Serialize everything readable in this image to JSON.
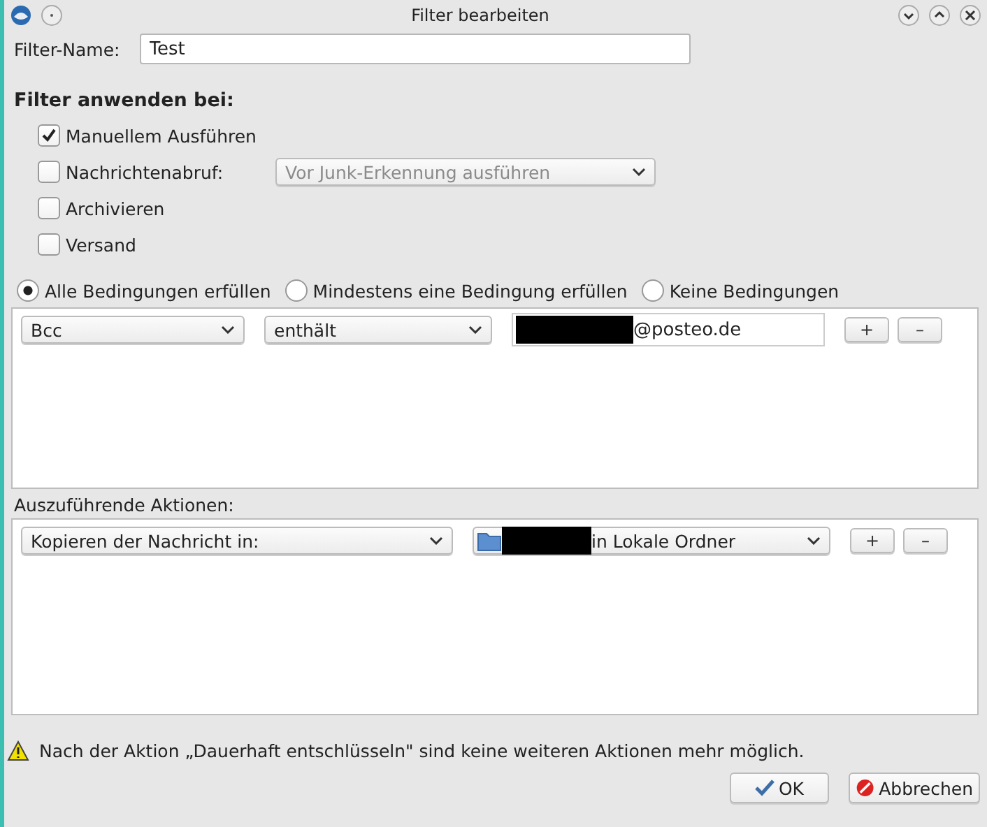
{
  "window": {
    "title": "Filter bearbeiten"
  },
  "filter_name": {
    "label": "Filter-Name:",
    "value": "Test"
  },
  "apply_section": {
    "heading": "Filter anwenden bei:",
    "options": [
      {
        "label": "Manuellem Ausführen",
        "checked": true
      },
      {
        "label": "Nachrichtenabruf:",
        "checked": false,
        "dropdown": {
          "value": "Vor Junk-Erkennung ausführen",
          "disabled": true
        }
      },
      {
        "label": "Archivieren",
        "checked": false
      },
      {
        "label": "Versand",
        "checked": false
      }
    ]
  },
  "match_modes": [
    {
      "label": "Alle Bedingungen erfüllen",
      "selected": true
    },
    {
      "label": "Mindestens eine Bedingung erfüllen",
      "selected": false
    },
    {
      "label": "Keine Bedingungen",
      "selected": false
    }
  ],
  "conditions": [
    {
      "field": "Bcc",
      "operator": "enthält",
      "value": "@posteo.de",
      "redacted": true,
      "add_button": "+",
      "remove_button": "–"
    }
  ],
  "actions_label": "Auszuführende Aktionen:",
  "actions": [
    {
      "action": "Kopieren der Nachricht in:",
      "target": "in Lokale Ordner",
      "redacted": true,
      "add_button": "+",
      "remove_button": "–"
    }
  ],
  "warning": "Nach der Aktion „Dauerhaft entschlüsseln\" sind keine weiteren Aktionen mehr möglich.",
  "buttons": [
    {
      "label": "OK",
      "kind": "ok"
    },
    {
      "label": "Abbrechen",
      "kind": "cancel"
    }
  ]
}
